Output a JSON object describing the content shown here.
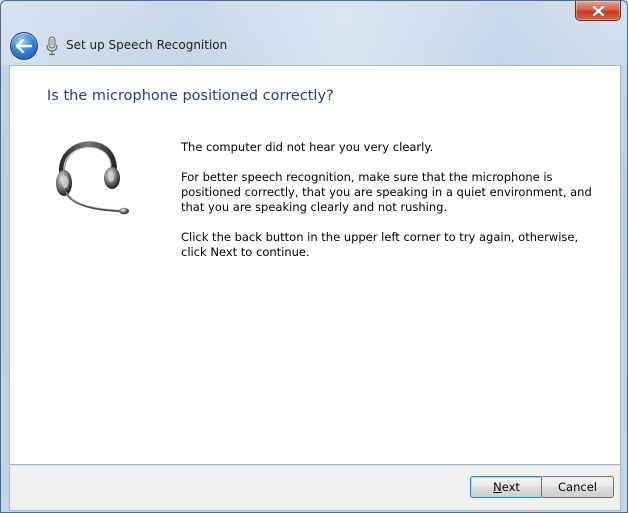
{
  "window": {
    "title": "Set up Speech Recognition",
    "close_tooltip_icon": "close-icon"
  },
  "page": {
    "heading": "Is the microphone positioned correctly?",
    "paragraphs": [
      "The computer did not hear you very clearly.",
      "For better speech recognition, make sure that the microphone is positioned correctly, that you are speaking in a quiet environment, and that you are speaking clearly and not rushing.",
      "Click the back button in the upper left corner to try again, otherwise, click Next to continue."
    ]
  },
  "buttons": {
    "next_mnemonic": "N",
    "next_rest": "ext",
    "cancel": "Cancel"
  },
  "colors": {
    "heading": "#1e3e8c",
    "close_button": "#c23d22",
    "back_button": "#3d86d8"
  }
}
